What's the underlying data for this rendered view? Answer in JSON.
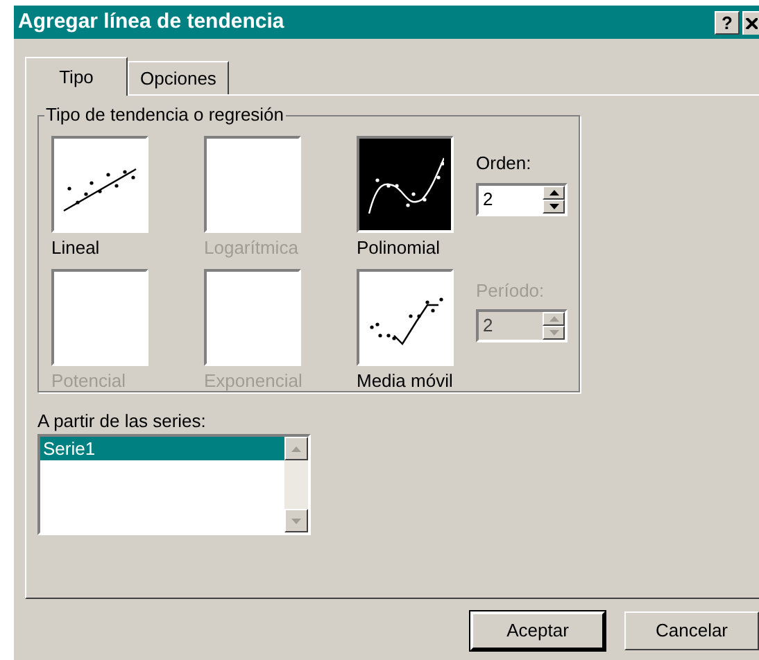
{
  "window": {
    "title": "Agregar línea de tendencia",
    "help_button": "?"
  },
  "tabs": [
    {
      "label": "Tipo",
      "selected": true
    },
    {
      "label": "Opciones",
      "selected": false
    }
  ],
  "trend_group": {
    "title": "Tipo de tendencia o regresión",
    "types": [
      {
        "label": "Lineal",
        "kind": "linear",
        "selected": false,
        "disabled": false
      },
      {
        "label": "Logarítmica",
        "kind": "blank",
        "selected": false,
        "disabled": true
      },
      {
        "label": "Polinomial",
        "kind": "polynomial",
        "selected": true,
        "disabled": false
      },
      {
        "label": "Potencial",
        "kind": "blank",
        "selected": false,
        "disabled": true
      },
      {
        "label": "Exponencial",
        "kind": "blank",
        "selected": false,
        "disabled": true
      },
      {
        "label": "Media móvil",
        "kind": "moving_average",
        "selected": false,
        "disabled": false
      }
    ],
    "order": {
      "label": "Orden:",
      "value": "2",
      "disabled": false
    },
    "period": {
      "label": "Período:",
      "value": "2",
      "disabled": true
    }
  },
  "series": {
    "label": "A partir de las series:",
    "items": [
      {
        "label": "Serie1",
        "selected": true
      }
    ]
  },
  "buttons": [
    "Aceptar",
    "Cancelar"
  ]
}
